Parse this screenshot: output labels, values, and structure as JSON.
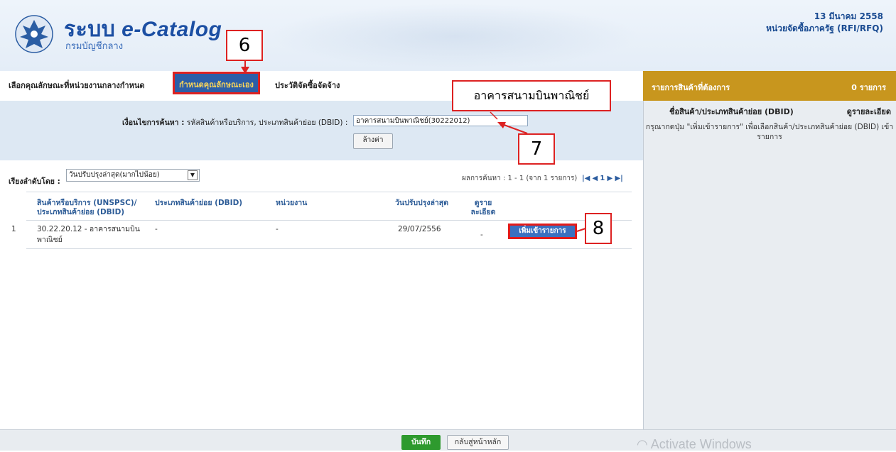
{
  "header": {
    "title_prefix": "ระบบ",
    "title_main": "e-Catalog",
    "subtitle": "กรมบัญชีกลาง",
    "date": "13 มีนาคม 2558",
    "unit": "หน่วยจัดซื้อภาครัฐ (RFI/RFQ)"
  },
  "tabs": [
    {
      "label": "เลือกคุณลักษณะที่หน่วยงานกลางกำหนด",
      "active": false
    },
    {
      "label": "กำหนดคุณลักษณะเอง",
      "active": true
    },
    {
      "label": "ประวัติจัดซื้อจัดจ้าง",
      "active": false
    }
  ],
  "right_panel": {
    "title": "รายการสินค้าที่ต้องการ",
    "count": "0 รายการ",
    "col_name": "ชื่อสินค้า/ประเภทสินค้าย่อย (DBID)",
    "col_detail": "ดูรายละเอียด",
    "message": "กรุณากดปุ่ม \"เพิ่มเข้ารายการ\" เพื่อเลือกสินค้า/ประเภทสินค้าย่อย (DBID) เข้ารายการ"
  },
  "criteria": {
    "label_bold": "เงื่อนไขการค้นหา :",
    "label_rest": "รหัสสินค้าหรือบริการ, ประเภทสินค้าย่อย (DBID) :",
    "value": "อาคารสนามบินพาณิชย์(30222012)",
    "clear_button": "ล้างค่า"
  },
  "sort": {
    "label": "เรียงลำดับโดย :",
    "selected": "วันปรับปรุงล่าสุด(มากไปน้อย)"
  },
  "paging": {
    "text": "ผลการค้นหา : 1 - 1 (จาก 1 รายการ)",
    "page": "1"
  },
  "table": {
    "headers": [
      "สินค้าหรือบริการ (UNSPSC)/ ประเภทสินค้าย่อย (DBID)",
      "ประเภทสินค้าย่อย (DBID)",
      "หน่วยงาน",
      "วันปรับปรุงล่าสุด",
      "ดูราย ละเอียด"
    ],
    "rows": [
      {
        "no": "1",
        "item": "30.22.20.12 - อาคารสนามบิน พาณิชย์",
        "dbid": "-",
        "agency": "-",
        "updated": "29/07/2556",
        "detail": "-",
        "action": "เพิ่มเข้ารายการ"
      }
    ]
  },
  "footer": {
    "save": "บันทึก",
    "home": "กลับสู่หน้าหลัก",
    "watermark": "Activate Windows"
  },
  "annotations": {
    "n6": "6",
    "n7": "7",
    "n8": "8",
    "note": "อาคารสนามบินพาณิชย์"
  },
  "colors": {
    "accent": "#2c5ea8",
    "panel_header": "#c8961e",
    "callout_border": "#d22222",
    "save_green": "#2e9a2e"
  }
}
